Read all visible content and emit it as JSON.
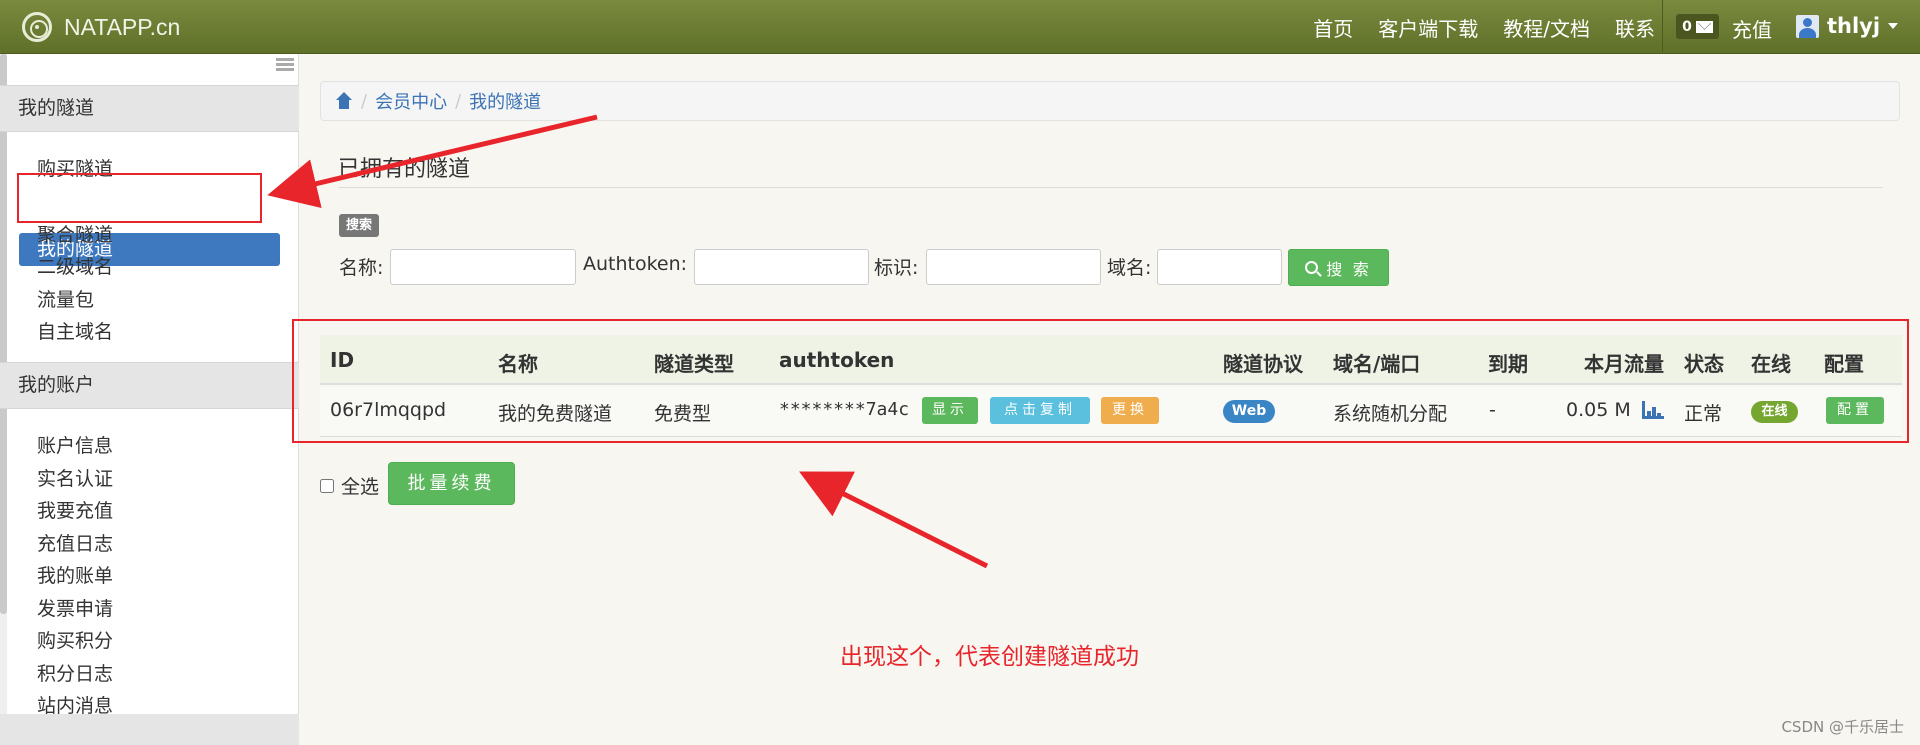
{
  "header": {
    "brand": "NATAPP.cn",
    "nav": [
      "首页",
      "客户端下载",
      "教程/文档",
      "联系"
    ],
    "mail_count": "0",
    "recharge": "充值",
    "username": "thlyj"
  },
  "sidebar": {
    "tunnels_title": "我的隧道",
    "tunnel_items": [
      "购买隧道",
      "我的隧道",
      "聚合隧道",
      "二级域名",
      "流量包",
      "自主域名"
    ],
    "account_title": "我的账户",
    "account_items": [
      "账户信息",
      "实名认证",
      "我要充值",
      "充值日志",
      "我的账单",
      "发票申请",
      "购买积分",
      "积分日志",
      "站内消息"
    ]
  },
  "breadcrumb": [
    "会员中心",
    "我的隧道"
  ],
  "main": {
    "title": "已拥有的隧道",
    "search_tag": "搜索",
    "filters": {
      "name_label": "名称:",
      "authtoken_label": "Authtoken:",
      "id_label": "标识:",
      "domain_label": "域名:"
    },
    "search_button": "搜 索"
  },
  "table": {
    "headers": [
      "ID",
      "名称",
      "隧道类型",
      "authtoken",
      "隧道协议",
      "域名/端口",
      "到期",
      "本月流量",
      "状态",
      "在线",
      "配置"
    ],
    "row": {
      "id": "06r7lmqqpd",
      "name": "我的免费隧道",
      "type": "免费型",
      "authtoken": "********7a4c",
      "show_btn": "显示",
      "copy_btn": "点击复制",
      "change_btn": "更换",
      "protocol": "Web",
      "domain": "系统随机分配",
      "expire": "-",
      "traffic": "0.05 M",
      "status": "正常",
      "online": "在线",
      "config_btn": "配置"
    }
  },
  "footer": {
    "select_all": "全选",
    "batch_renew": "批量续费"
  },
  "annotation": "出现这个，代表创建隧道成功",
  "watermark": "CSDN @千乐居士",
  "colors": {
    "header_green": "#6b7c31",
    "primary_blue": "#3e79bf",
    "success_green": "#5cb85c",
    "annotation_red": "#e8252b"
  }
}
